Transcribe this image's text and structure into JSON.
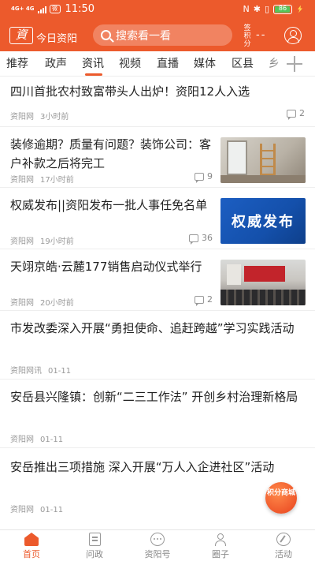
{
  "status_bar": {
    "network": "4G+ 4G",
    "wechat": "微",
    "time": "11:50",
    "icons": [
      "nfc-icon",
      "bluetooth-icon",
      "vibrate-icon",
      "battery-icon",
      "charging-icon"
    ],
    "battery": "86"
  },
  "header": {
    "logo_text": "資",
    "app_name": "今日资阳",
    "search_placeholder": "搜索看一看",
    "points_label": "积分",
    "points_prefix": "签",
    "points_value": "--",
    "accent_color": "#ec5a2c"
  },
  "tabs": [
    {
      "label": "推荐"
    },
    {
      "label": "政声"
    },
    {
      "label": "资讯"
    },
    {
      "label": "视频"
    },
    {
      "label": "直播"
    },
    {
      "label": "媒体"
    },
    {
      "label": "区县"
    },
    {
      "label": "乡"
    }
  ],
  "active_tab": "资讯",
  "news": [
    {
      "title": "四川首批农村致富带头人出炉！资阳12人入选",
      "source": "资阳网",
      "time": "3小时前",
      "comments": "2"
    },
    {
      "title": "装修逾期？质量有问题？装饰公司：客户补款之后将完工",
      "source": "资阳网",
      "time": "17小时前",
      "comments": "9",
      "thumb": "renovation-photo"
    },
    {
      "title": "权威发布||资阳发布一批人事任免名单",
      "source": "资阳网",
      "time": "19小时前",
      "comments": "36",
      "thumb_text": "权威发布"
    },
    {
      "title": "天翊京皓·云麓177销售启动仪式举行",
      "source": "资阳网",
      "time": "20小时前",
      "comments": "2",
      "thumb": "ceremony-photo"
    },
    {
      "title": "市发改委深入开展“勇担使命、追赶跨越”学习实践活动",
      "source": "资阳网讯",
      "time": "01-11"
    },
    {
      "title": "安岳县兴隆镇：创新“二三工作法” 开创乡村治理新格局",
      "source": "资阳网",
      "time": "01-11"
    },
    {
      "title": "安岳推出三项措施 深入开展“万人入企进社区”活动",
      "source": "资阳网",
      "time": "01-11"
    }
  ],
  "float_badge": "积分商城",
  "bottom_nav": [
    {
      "label": "首页",
      "icon": "home-icon"
    },
    {
      "label": "问政",
      "icon": "document-icon"
    },
    {
      "label": "资阳号",
      "icon": "chat-dots-icon"
    },
    {
      "label": "圈子",
      "icon": "people-icon"
    },
    {
      "label": "活动",
      "icon": "compass-icon"
    }
  ]
}
